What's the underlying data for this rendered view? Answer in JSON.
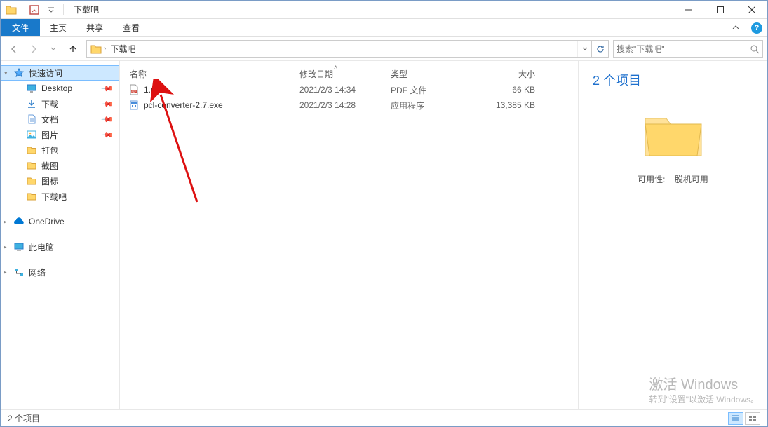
{
  "window": {
    "title": "下载吧"
  },
  "ribbon": {
    "file": "文件",
    "tabs": [
      "主页",
      "共享",
      "查看"
    ]
  },
  "nav": {
    "breadcrumb": [
      "下载吧"
    ],
    "search_placeholder": "搜索\"下载吧\""
  },
  "sidebar": {
    "quick_access": "快速访问",
    "items": [
      {
        "label": "Desktop",
        "icon": "desktop"
      },
      {
        "label": "下载",
        "icon": "download"
      },
      {
        "label": "文档",
        "icon": "document"
      },
      {
        "label": "图片",
        "icon": "picture"
      },
      {
        "label": "打包",
        "icon": "folder"
      },
      {
        "label": "截图",
        "icon": "folder"
      },
      {
        "label": "图标",
        "icon": "folder"
      },
      {
        "label": "下载吧",
        "icon": "folder"
      }
    ],
    "onedrive": "OneDrive",
    "thispc": "此电脑",
    "network": "网络"
  },
  "columns": {
    "name": "名称",
    "date": "修改日期",
    "type": "类型",
    "size": "大小"
  },
  "files": [
    {
      "name": "1.pdf",
      "date": "2021/2/3 14:34",
      "type": "PDF 文件",
      "size": "66 KB",
      "icon": "pdf"
    },
    {
      "name": "pcl-converter-2.7.exe",
      "date": "2021/2/3 14:28",
      "type": "应用程序",
      "size": "13,385 KB",
      "icon": "exe"
    }
  ],
  "preview": {
    "title": "2 个项目",
    "availability_label": "可用性:",
    "availability_value": "脱机可用"
  },
  "status": {
    "text": "2 个项目"
  },
  "watermark": {
    "l1": "激活 Windows",
    "l2": "转到\"设置\"以激活 Windows。"
  }
}
